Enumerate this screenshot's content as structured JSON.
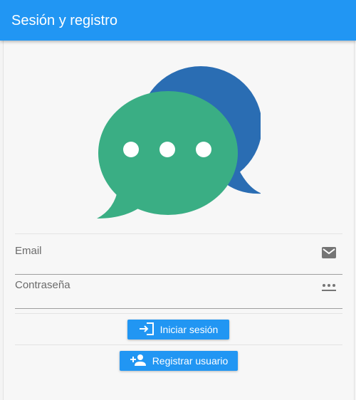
{
  "app": {
    "title": "Sesión y registro"
  },
  "form": {
    "email_label": "Email",
    "password_label": "Contraseña"
  },
  "buttons": {
    "login_label": "Iniciar sesión",
    "register_label": "Registrar usuario"
  },
  "icons": {
    "logo": "chat-bubbles-icon",
    "email": "mail-icon",
    "password": "password-dots-icon",
    "login": "login-icon",
    "register": "person-add-icon"
  },
  "colors": {
    "primary": "#2196f3",
    "logo_back": "#2a6db3",
    "logo_front": "#3aae84"
  }
}
